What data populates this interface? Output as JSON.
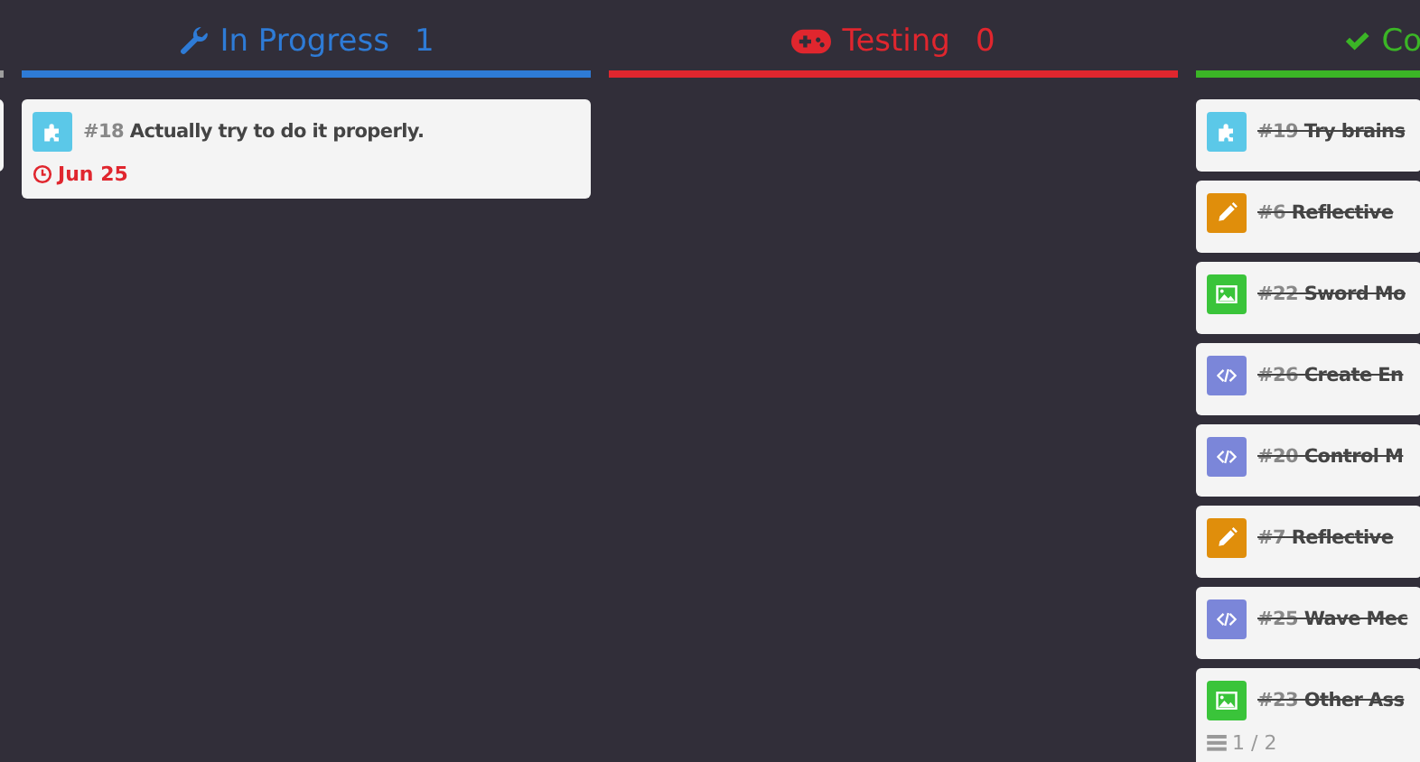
{
  "columns": [
    {
      "kind": "plain",
      "color": "#9e9e9e",
      "cards": [
        {
          "kind": "blank",
          "done": false,
          "color": "#f4f4f4"
        }
      ]
    },
    {
      "kind": "wrench",
      "title": "In Progress",
      "count": "1",
      "color": "#2e7bd6",
      "cards": [
        {
          "number": "#18",
          "title": "Actually try to do it properly.",
          "done": false,
          "kind": "puzzle",
          "color": "#5bc8e8",
          "due": "Jun 25"
        }
      ]
    },
    {
      "kind": "gamepad",
      "title": "Testing",
      "count": "0",
      "color": "#e0262e"
    },
    {
      "kind": "check",
      "title": "Co",
      "color": "#3bb526",
      "cards": [
        {
          "number": "#19",
          "title": "Try brains",
          "done": true,
          "kind": "puzzle",
          "color": "#5bc8e8"
        },
        {
          "number": "#6",
          "title": "Reflective",
          "done": true,
          "kind": "pencil",
          "color": "#e08e0b"
        },
        {
          "number": "#22",
          "title": "Sword Mo",
          "done": true,
          "kind": "image",
          "color": "#3ac43a"
        },
        {
          "number": "#26",
          "title": "Create En",
          "done": true,
          "kind": "code",
          "color": "#7b86d9"
        },
        {
          "number": "#20",
          "title": "Control M",
          "done": true,
          "kind": "code",
          "color": "#7b86d9"
        },
        {
          "number": "#7",
          "title": "Reflective",
          "done": true,
          "kind": "pencil",
          "color": "#e08e0b"
        },
        {
          "number": "#25",
          "title": "Wave Mec",
          "done": true,
          "kind": "code",
          "color": "#7b86d9"
        },
        {
          "number": "#23",
          "title": "Other Ass",
          "done": true,
          "kind": "image",
          "color": "#3ac43a",
          "subtasks": "1 / 2"
        }
      ]
    }
  ]
}
